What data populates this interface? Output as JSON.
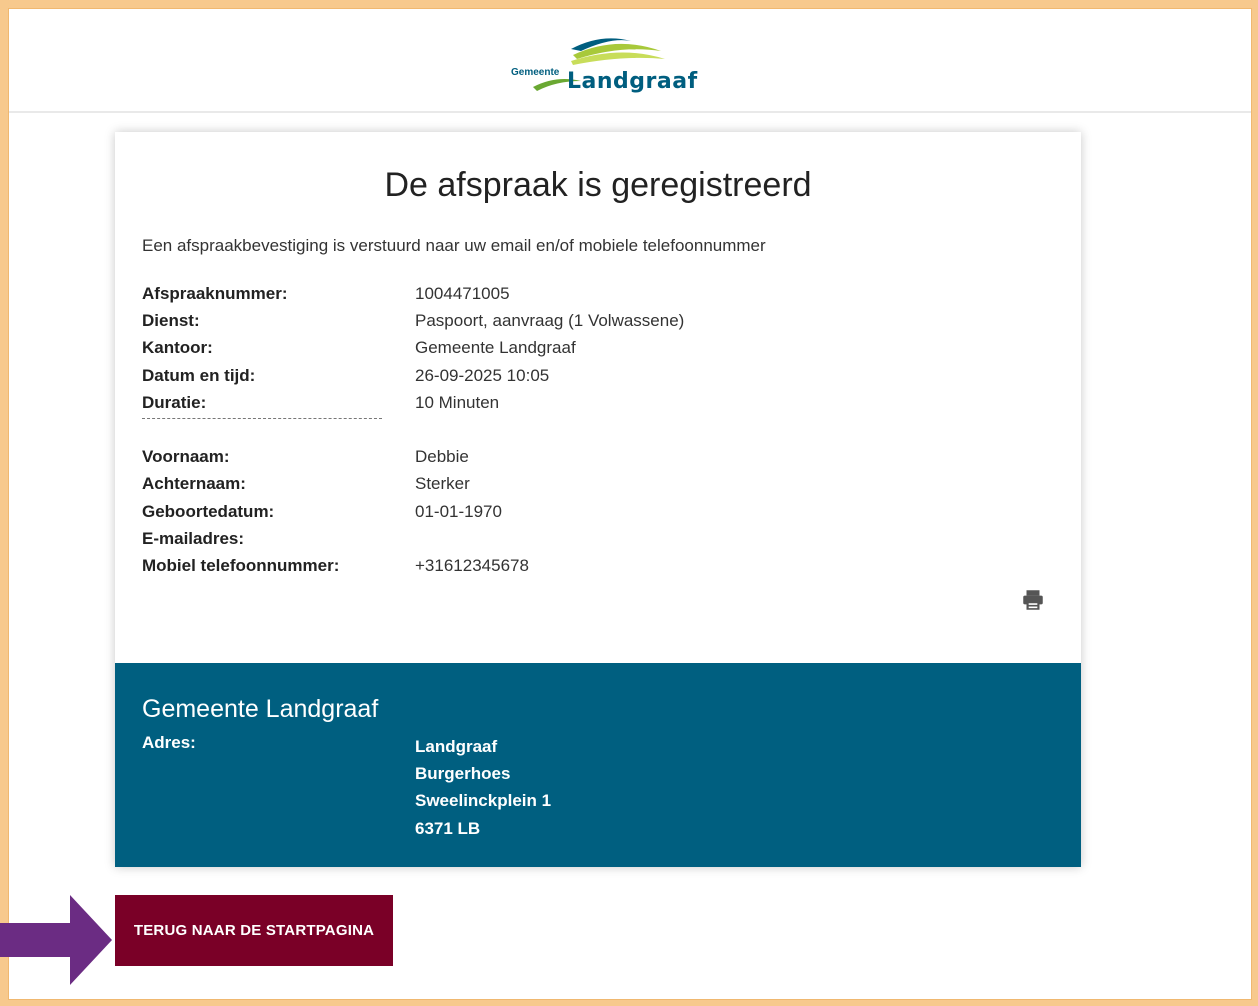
{
  "logo": {
    "small_text": "Gemeente",
    "big_text": "Landgraaf"
  },
  "title": "De afspraak is geregistreerd",
  "intro": "Een afspraakbevestiging is verstuurd naar uw email en/of mobiele telefoonnummer",
  "appointment": [
    {
      "label": "Afspraaknummer:",
      "value": "1004471005"
    },
    {
      "label": "Dienst:",
      "value": "Paspoort, aanvraag (1 Volwassene)"
    },
    {
      "label": "Kantoor:",
      "value": "Gemeente Landgraaf"
    },
    {
      "label": "Datum en tijd:",
      "value": "26-09-2025 10:05"
    },
    {
      "label": "Duratie:",
      "value": "10 Minuten"
    }
  ],
  "person": [
    {
      "label": "Voornaam:",
      "value": "Debbie"
    },
    {
      "label": "Achternaam:",
      "value": "Sterker"
    },
    {
      "label": "Geboortedatum:",
      "value": "01-01-1970"
    },
    {
      "label": "E-mailadres:",
      "value": ""
    },
    {
      "label": "Mobiel telefoonnummer:",
      "value": "+31612345678"
    }
  ],
  "print_icon": "printer-icon",
  "office": {
    "name": "Gemeente Landgraaf",
    "address_label": "Adres:",
    "address_lines": [
      "Landgraaf",
      "Burgerhoes",
      "Sweelinckplein 1",
      "6371 LB"
    ]
  },
  "back_button": "TERUG NAAR DE STARTPAGINA",
  "colors": {
    "frame": "#f7c98d",
    "office_box": "#005f80",
    "button": "#7a0027",
    "arrow": "#6b2c83"
  }
}
